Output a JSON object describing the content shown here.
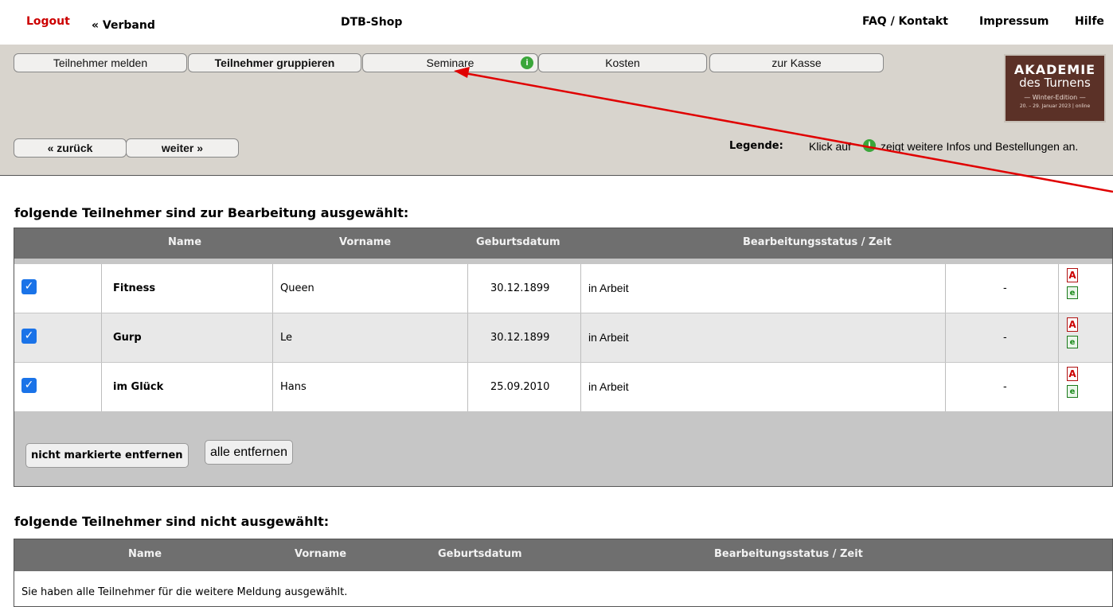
{
  "topbar": {
    "logout": "Logout",
    "verband": "« Verband",
    "shop": "DTB-Shop",
    "faq": "FAQ / Kontakt",
    "impressum": "Impressum",
    "hilfe": "Hilfe"
  },
  "nav": {
    "teilnehmer_melden": "Teilnehmer melden",
    "teilnehmer_gruppieren": "Teilnehmer gruppieren",
    "seminare": "Seminare",
    "kosten": "Kosten",
    "zur_kasse": "zur Kasse",
    "zurueck": "« zurück",
    "weiter": "weiter »"
  },
  "logo": {
    "line1": "AKADEMIE",
    "line2": "des Turnens",
    "line3": "— Winter-Edition —",
    "line4": "20. – 29. Januar 2023 | online"
  },
  "legend": {
    "label": "Legende:",
    "text_before": "Klick auf",
    "text_after": "zeigt weitere Infos und Bestellungen an."
  },
  "selected": {
    "heading": "folgende Teilnehmer sind zur Bearbeitung ausgewählt:",
    "columns": [
      "Name",
      "Vorname",
      "Geburtsdatum",
      "Bearbeitungsstatus / Zeit"
    ],
    "rows": [
      {
        "name": "Fitness",
        "vorname": "Queen",
        "geburtsdatum": "30.12.1899",
        "status": "in Arbeit",
        "zeit": "-"
      },
      {
        "name": "Gurp",
        "vorname": "Le",
        "geburtsdatum": "30.12.1899",
        "status": "in Arbeit",
        "zeit": "-"
      },
      {
        "name": "im Glück",
        "vorname": "Hans",
        "geburtsdatum": "25.09.2010",
        "status": "in Arbeit",
        "zeit": "-"
      }
    ],
    "btn_remove_unmarked": "nicht markierte entfernen",
    "btn_remove_all": "alle entfernen"
  },
  "unselected": {
    "heading": "folgende Teilnehmer sind nicht ausgewählt:",
    "columns": [
      "Name",
      "Vorname",
      "Geburtsdatum",
      "Bearbeitungsstatus / Zeit"
    ],
    "message": "Sie haben alle Teilnehmer für die weitere Meldung ausgewählt."
  },
  "colors": {
    "logout": "#cc0000",
    "toolbar_bg": "#d8d4cd",
    "table_header": "#6f6f6f",
    "info_icon": "#3aa63a",
    "annotation_arrow": "#e00000"
  }
}
